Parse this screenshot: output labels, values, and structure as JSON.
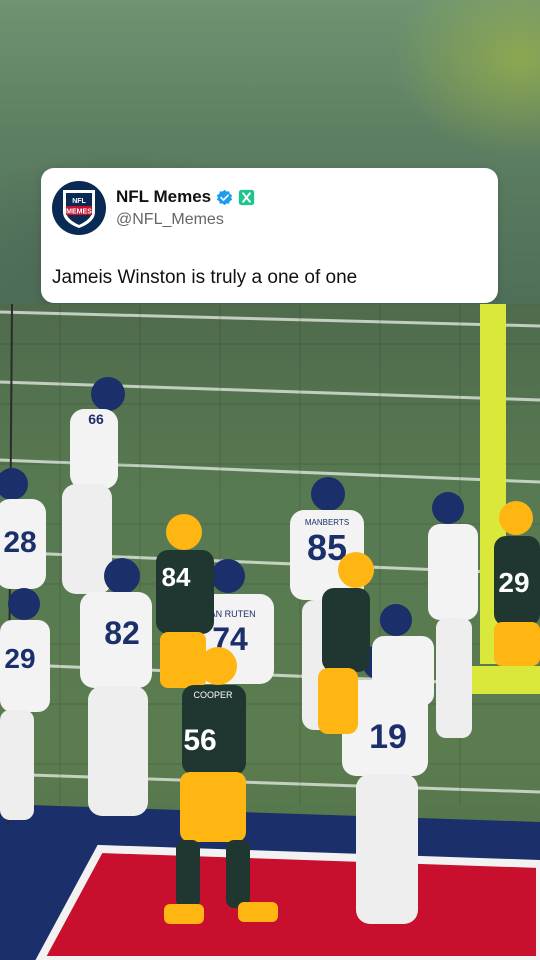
{
  "tweet": {
    "author_name": "NFL Memes",
    "handle": "@NFL_Memes",
    "text": "Jameis Winston is truly a one of one",
    "avatar_logo_top": "NFL",
    "avatar_logo_bottom": "MEMES"
  },
  "colors": {
    "verified_badge": "#1d9bf0",
    "affiliate_badge": "#21c48a",
    "giants_blue": "#1b2f6b",
    "endzone_red": "#c8102e",
    "packers_green": "#203731",
    "packers_gold": "#ffb612"
  },
  "photo": {
    "jersey_numbers": [
      "66",
      "28",
      "85",
      "84",
      "82",
      "74",
      "56",
      "19",
      "29",
      "29"
    ],
    "nameplates": [
      "MANBERTS",
      "VAN RUTEN",
      "COOPER"
    ]
  }
}
